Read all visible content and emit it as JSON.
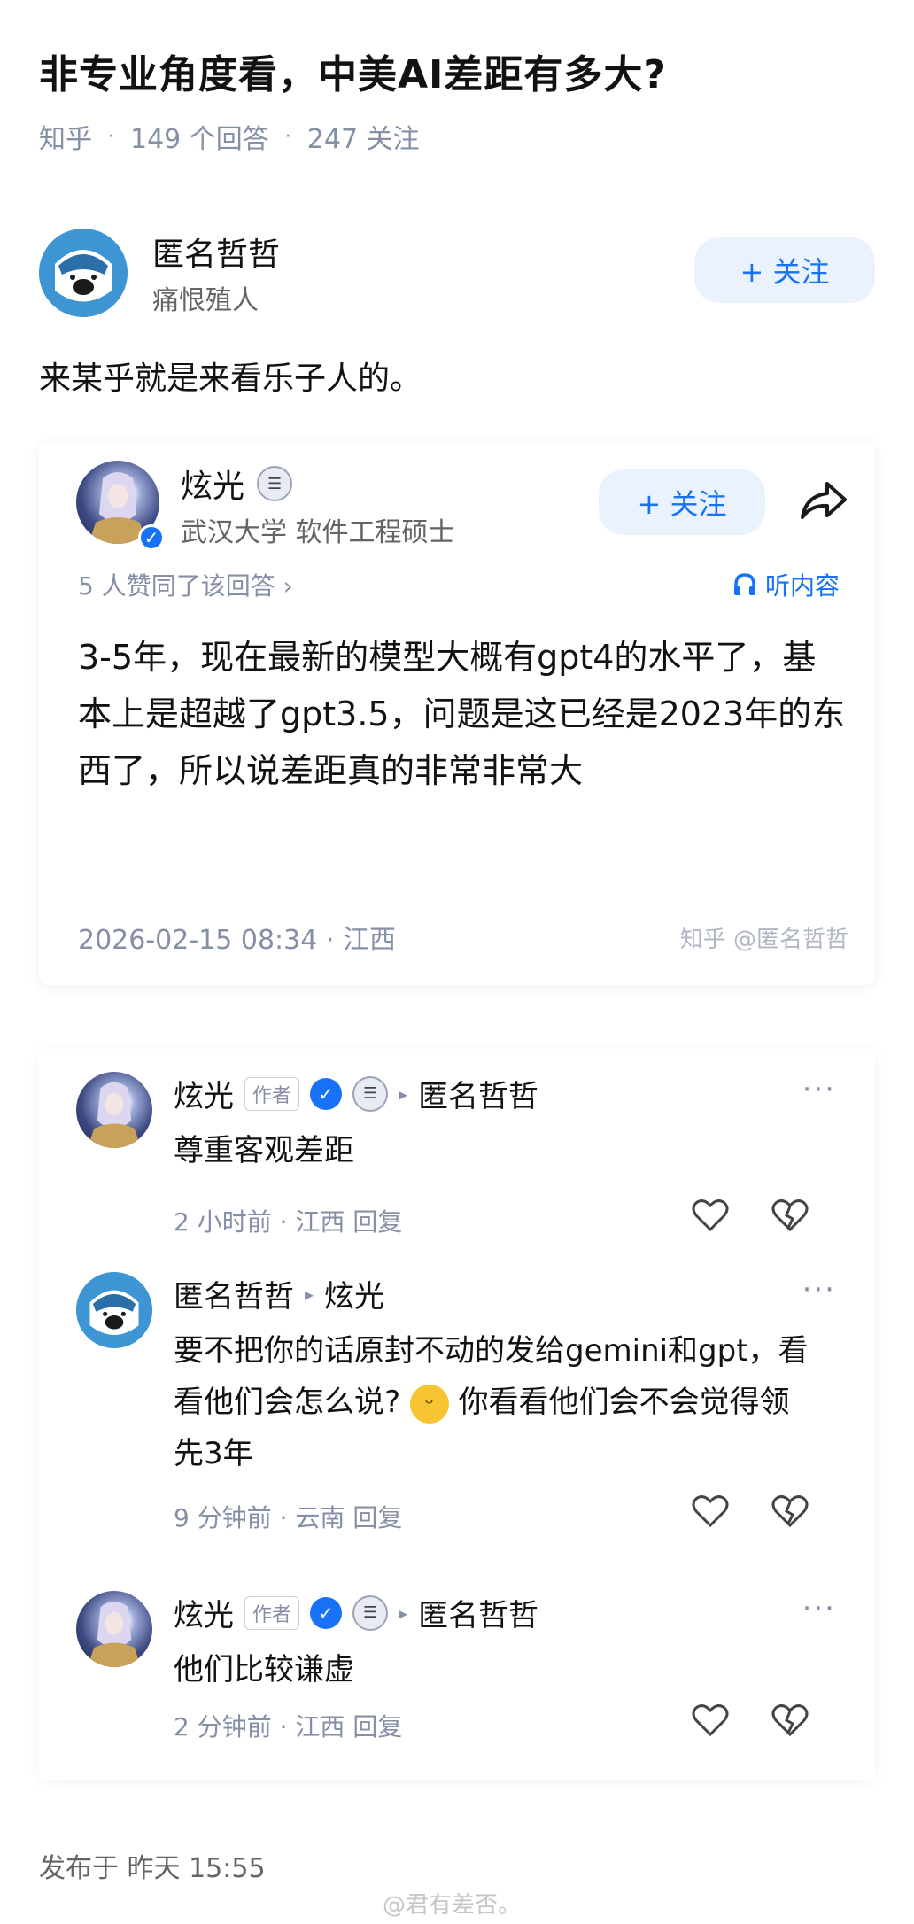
{
  "question": {
    "title": "非专业角度看，中美AI差距有多大?",
    "source": "知乎",
    "answers_count": "149 个回答",
    "followers_count": "247 关注"
  },
  "author": {
    "name": "匿名哲哲",
    "bio": "痛恨殖人",
    "follow_label": "+ 关注"
  },
  "answer": {
    "text": "来某乎就是来看乐子人的。"
  },
  "quoted": {
    "name": "炫光",
    "bio": "武汉大学 软件工程硕士",
    "follow_label": "+ 关注",
    "agree_text": "5 人赞同了该回答 ›",
    "listen_label": "听内容",
    "text": "3-5年，现在最新的模型大概有gpt4的水平了，基本上是超越了gpt3.5，问题是这已经是2023年的东西了，所以说差距真的非常非常大",
    "date": "2026-02-15 08:34 · 江西",
    "watermark": "知乎 @匿名哲哲"
  },
  "comments": [
    {
      "name": "炫光",
      "tag": "作者",
      "reply_to": "匿名哲哲",
      "text": "尊重客观差距",
      "meta": "2 小时前 · 江西 回复"
    },
    {
      "name": "匿名哲哲",
      "reply_to": "炫光",
      "text_part1": "要不把你的话原封不动的发给gemini和gpt，看看他们会怎么说?",
      "text_part2": "你看看他们会不会觉得领先3年",
      "meta": "9 分钟前 · 云南 回复"
    },
    {
      "name": "炫光",
      "tag": "作者",
      "reply_to": "匿名哲哲",
      "text": "他们比较谦虚",
      "meta": "2 分钟前 · 江西 回复"
    }
  ],
  "footer": {
    "published": "发布于  昨天 15:55",
    "weibo_watermark": "@君有差否。"
  },
  "icons": {
    "share": "share-arrow-icon",
    "heart": "heart-icon",
    "broken_heart": "broken-heart-icon",
    "headphone": "headphone-icon",
    "more": "more-dots-icon"
  },
  "colors": {
    "accent": "#1772f6",
    "follow_bg": "#eaf2fd",
    "muted": "#8590a6"
  }
}
